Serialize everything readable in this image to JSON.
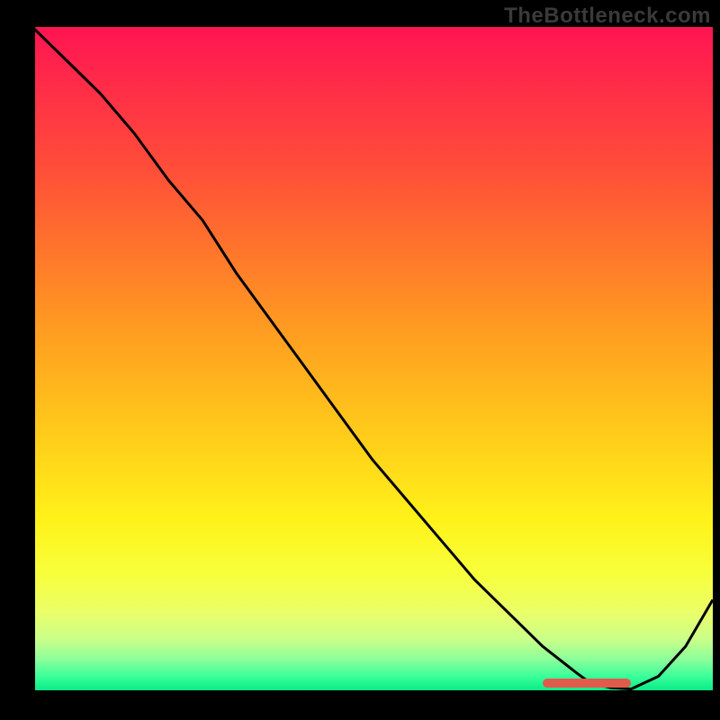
{
  "watermark": "TheBottleneck.com",
  "colors": {
    "marker": "#e15a4c",
    "curve": "#000000"
  },
  "chart_data": {
    "type": "line",
    "title": "",
    "xlabel": "",
    "ylabel": "",
    "xlim": [
      0,
      100
    ],
    "ylim": [
      0,
      100
    ],
    "grid": false,
    "legend": false,
    "series": [
      {
        "name": "bottleneck-curve",
        "x": [
          0,
          5,
          10,
          15,
          20,
          25,
          30,
          35,
          40,
          45,
          50,
          55,
          60,
          65,
          70,
          75,
          80,
          82,
          85,
          88,
          92,
          96,
          100
        ],
        "y": [
          100,
          95,
          90,
          84,
          77,
          71,
          63,
          56,
          49,
          42,
          35,
          29,
          23,
          17,
          12,
          7,
          3,
          1.5,
          0.8,
          0.6,
          2.5,
          7,
          14
        ]
      }
    ],
    "marker": {
      "x_start": 75,
      "x_end": 88,
      "y": 0.6
    },
    "gradient_stops": [
      {
        "pct": 0,
        "color": "#ff1452"
      },
      {
        "pct": 50,
        "color": "#ffb81f"
      },
      {
        "pct": 80,
        "color": "#fff21a"
      },
      {
        "pct": 100,
        "color": "#00e884"
      }
    ]
  }
}
